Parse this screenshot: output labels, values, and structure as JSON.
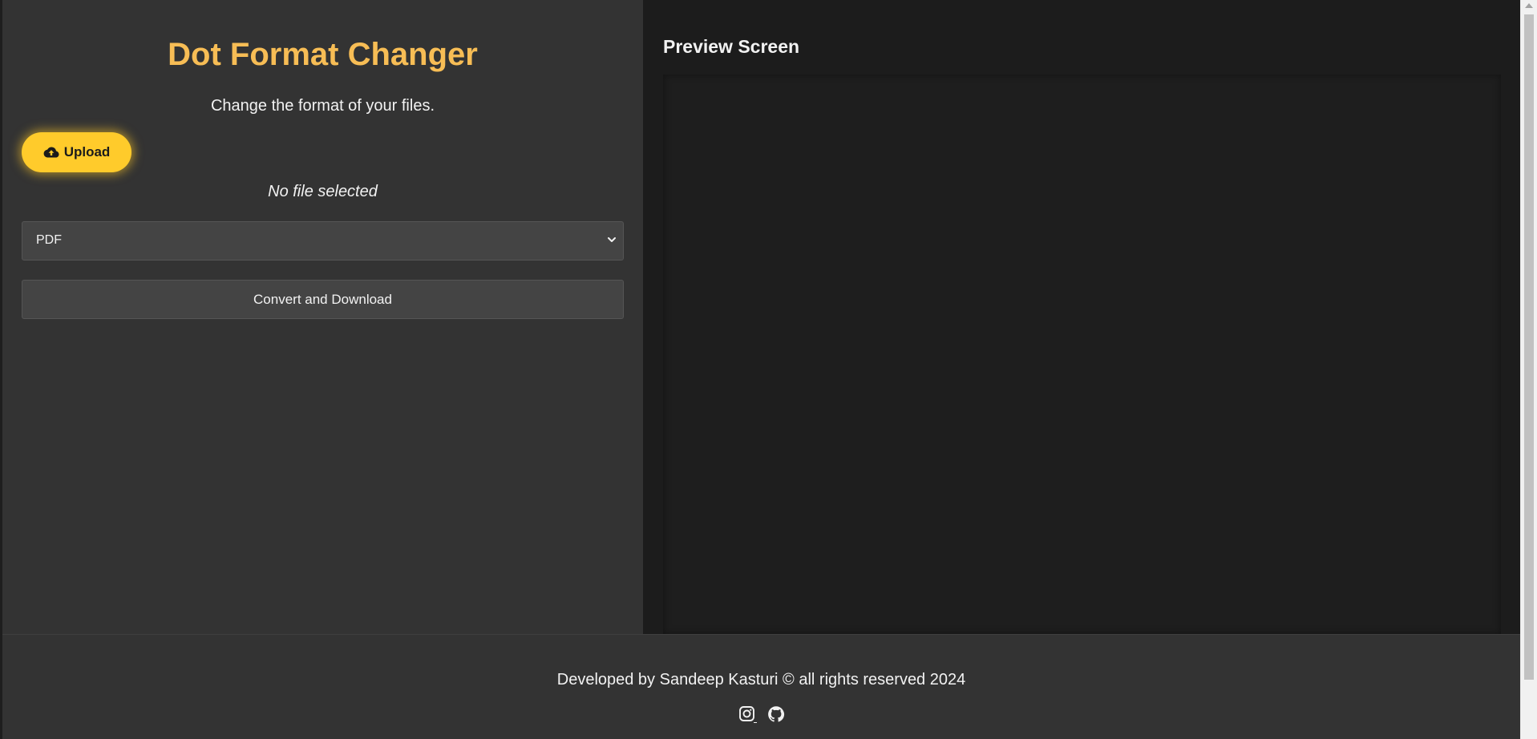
{
  "app": {
    "title": "Dot Format Changer",
    "subtitle": "Change the format of your files."
  },
  "upload": {
    "label": "Upload",
    "icon": "cloud-upload-icon"
  },
  "file_status": "No file selected",
  "format_select": {
    "selected": "PDF",
    "icon": "chevron-down-icon"
  },
  "convert": {
    "label": "Convert and Download"
  },
  "preview": {
    "heading": "Preview Screen"
  },
  "footer": {
    "text": "Developed by Sandeep Kasturi © all rights reserved 2024",
    "icons": [
      "instagram-icon",
      "github-icon"
    ]
  },
  "colors": {
    "accent": "#f7bd55",
    "upload_button": "#ffcb2b",
    "left_panel": "#333333",
    "right_panel": "#1c1c1c"
  }
}
